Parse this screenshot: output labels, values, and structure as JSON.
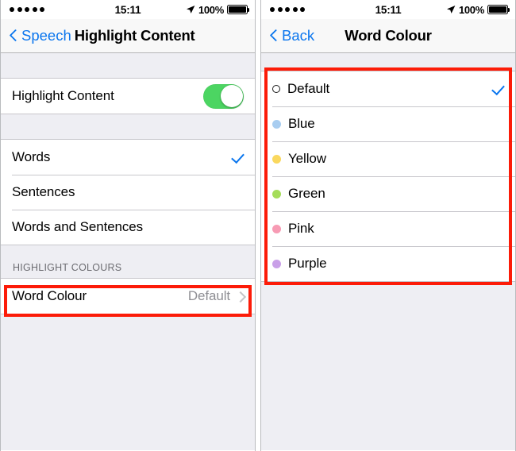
{
  "meta": {
    "accent_blue": "#0b76ee",
    "annotation_red": "#fc1b08",
    "toggle_green": "#4cd562",
    "value_grey": "#8e8e93"
  },
  "status_bar": {
    "signal_dots": 5,
    "time": "15:11",
    "battery_percent": "100%",
    "location_icon": "location-arrow-icon",
    "battery_icon": "battery-full-icon"
  },
  "left_panel": {
    "nav": {
      "back_icon": "chevron-left-icon",
      "back_label": "Speech",
      "title": "Highlight Content"
    },
    "toggle_row": {
      "label": "Highlight Content",
      "toggle_state": "on"
    },
    "mode_rows": [
      {
        "label": "Words",
        "selected": true
      },
      {
        "label": "Sentences",
        "selected": false
      },
      {
        "label": "Words and Sentences",
        "selected": false
      }
    ],
    "section_header": "HIGHLIGHT COLOURS",
    "word_colour_row": {
      "label": "Word Colour",
      "value": "Default",
      "chevron_icon": "chevron-right-icon",
      "highlighted": true
    }
  },
  "right_panel": {
    "nav": {
      "back_icon": "chevron-left-icon",
      "back_label": "Back",
      "title": "Word Colour"
    },
    "colour_rows": [
      {
        "label": "Default",
        "dot": "hollow",
        "colour": "#ffffff",
        "selected": true
      },
      {
        "label": "Blue",
        "dot": "filled",
        "colour": "#a8cdf0",
        "selected": false
      },
      {
        "label": "Yellow",
        "dot": "filled",
        "colour": "#fad85e",
        "selected": false
      },
      {
        "label": "Green",
        "dot": "filled",
        "colour": "#a5dd5a",
        "selected": false
      },
      {
        "label": "Pink",
        "dot": "filled",
        "colour": "#f79bb4",
        "selected": false
      },
      {
        "label": "Purple",
        "dot": "filled",
        "colour": "#c9a0e8",
        "selected": false
      }
    ],
    "check_icon": "checkmark-icon",
    "list_highlighted": true
  }
}
